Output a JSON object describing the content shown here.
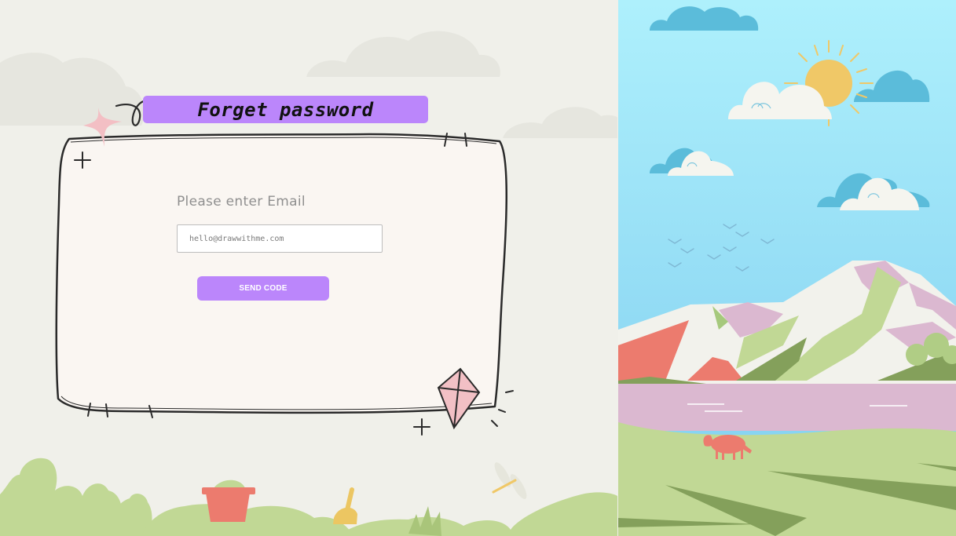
{
  "form": {
    "title": "Forget password",
    "email_label": "Please enter Email",
    "email_placeholder": "hello@drawwithme.com",
    "email_value": "",
    "send_button_label": "SEND CODE"
  },
  "colors": {
    "accent": "#bb86fb",
    "background": "#f0f0ea",
    "sky": "#aee9f8",
    "grass": "#c1d895"
  }
}
